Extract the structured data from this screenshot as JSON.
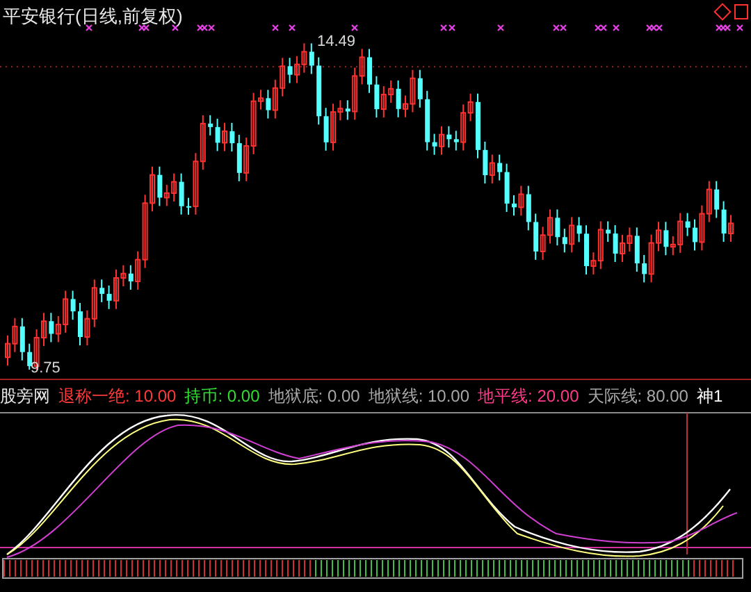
{
  "chart_title": "平安银行(日线,前复权)",
  "price_labels": {
    "high": "14.49",
    "low": "9.75"
  },
  "indicator": {
    "name": "股旁网",
    "legend": [
      {
        "label": "退称一绝:",
        "value": "10.00",
        "color": "#ff3a3a"
      },
      {
        "label": "持币:",
        "value": "0.00",
        "color": "#33dd33"
      },
      {
        "label": "地狱底:",
        "value": "0.00",
        "color": "#a8a8a8"
      },
      {
        "label": "地狱线:",
        "value": "10.00",
        "color": "#a8a8a8"
      },
      {
        "label": "地平线:",
        "value": "20.00",
        "color": "#ff3a8a"
      },
      {
        "label": "天际线:",
        "value": "80.00",
        "color": "#a8a8a8"
      },
      {
        "label": "神1",
        "color": "#ffffff"
      }
    ]
  }
}
